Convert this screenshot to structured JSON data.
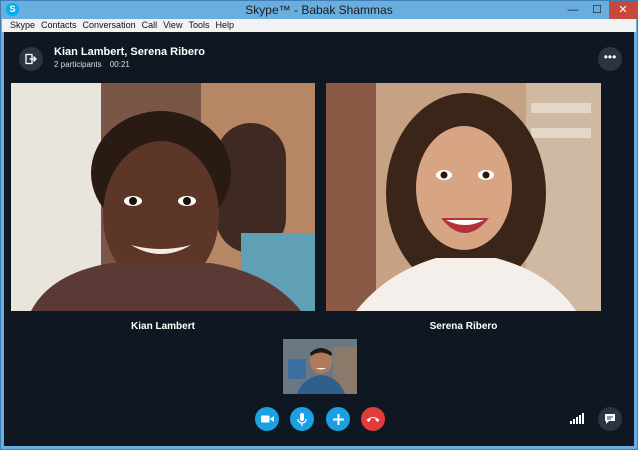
{
  "window": {
    "title": "Skype™ - Babak Shammas",
    "app_icon": "S",
    "controls": {
      "minimize": "—",
      "maximize": "☐",
      "close": "✕"
    }
  },
  "menu": [
    "Skype",
    "Contacts",
    "Conversation",
    "Call",
    "View",
    "Tools",
    "Help"
  ],
  "call": {
    "title": "Kian Lambert, Serena Ribero",
    "participants": "2 participants",
    "duration": "00:21",
    "more_label": "•••"
  },
  "participants": [
    {
      "name": "Kian Lambert"
    },
    {
      "name": "Serena Ribero"
    }
  ],
  "controls": {
    "video_icon": "video-camera-icon",
    "mic_icon": "microphone-icon",
    "add_icon": "plus-icon",
    "end_icon": "hang-up-icon"
  },
  "colors": {
    "accent": "#1ba1e2",
    "end_call": "#e23b3b",
    "background": "#0f1722"
  }
}
